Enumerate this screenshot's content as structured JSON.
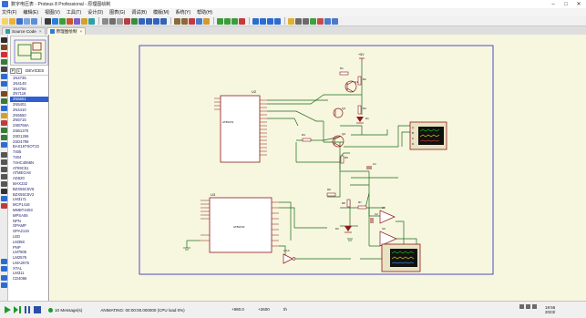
{
  "window": {
    "title": "数字电压表 - Proteus 8 Professional - 原理图绘制"
  },
  "menu": [
    "文件(F)",
    "编辑(E)",
    "视图(V)",
    "工具(T)",
    "设计(D)",
    "图表(G)",
    "调试(B)",
    "模版(M)",
    "系统(Y)",
    "帮助(H)"
  ],
  "tabs": [
    {
      "label": "Source Code",
      "active": false
    },
    {
      "label": "原理图绘制",
      "active": true
    }
  ],
  "panel": {
    "devices_label": "DEVICES",
    "buttons": [
      "P",
      "L"
    ],
    "devices": [
      "1N4735",
      "1N4148",
      "1N4756",
      "2N7116",
      "2N5551",
      "2N5401",
      "2N4410",
      "2N5550",
      "2N6715",
      "2SB766A",
      "2SB1370",
      "2SD1266",
      "2SD4799",
      "BAS16TSOT23",
      "7405",
      "7404",
      "74HC4066N",
      "AT89C51",
      "ATMEGA8",
      "AD620",
      "MAX232",
      "BZX55C5V6",
      "BZX55C5V2",
      "LM317L",
      "MCP1416",
      "MMBT4403",
      "MPSA06",
      "NPN",
      "OPAMP",
      "OPA2134",
      "LED",
      "LM358",
      "PNP",
      "LM7805",
      "LM2576",
      "LMA2576",
      "XTAL",
      "LM311",
      "CD4066"
    ],
    "selected_index": 4
  },
  "schematic": {
    "ic_top": {
      "ref": "U2",
      "part": "AT89C51"
    },
    "ic_bottom": {
      "ref": "U3",
      "part": "AT89C52"
    },
    "inverter": {
      "ref": "U4:A",
      "part": "74HC04"
    },
    "transistors": [
      {
        "ref": "Q1",
        "part": "NPN"
      },
      {
        "ref": "Q2",
        "part": "2N5551"
      },
      {
        "ref": "Q3",
        "part": "PNP"
      }
    ],
    "opamps": [
      {
        "ref": "U5",
        "part": "OPAMP"
      },
      {
        "ref": "U6",
        "part": "OPAMP"
      }
    ],
    "resistors": [
      "R1",
      "R2",
      "R3",
      "R4",
      "R5",
      "R6",
      "R7",
      "R8",
      "R9"
    ],
    "capacitors": [
      "C1",
      "C2"
    ],
    "diodes": [
      "D1",
      "D2"
    ],
    "power_label": "+5V",
    "scope_channels": [
      "A",
      "B",
      "C",
      "D"
    ]
  },
  "status": {
    "messages": "10 Message(s)",
    "animation": "ANIMATING: 00:00:00.000000 (CPU load 0%)",
    "coord_x": "+980.0",
    "coord_y": "+2600",
    "unit": "th",
    "time": "19:55",
    "date": "2023/"
  },
  "colors": {
    "canvas_bg": "#f7f6df",
    "wire": "#1b6b1b",
    "component": "#8b1a1a",
    "sheet_border": "#3b3bc4",
    "scope_trace_green": "#19c419",
    "scope_trace_yellow": "#e7d21b"
  }
}
